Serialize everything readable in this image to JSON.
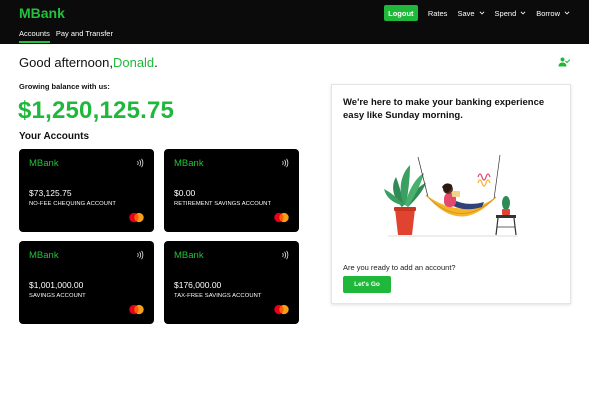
{
  "header": {
    "brand": "MBank",
    "logout_label": "Logout",
    "nav": [
      {
        "label": "Rates",
        "dropdown": false
      },
      {
        "label": "Save",
        "dropdown": true
      },
      {
        "label": "Spend",
        "dropdown": true
      },
      {
        "label": "Borrow",
        "dropdown": true
      }
    ],
    "tabs": [
      {
        "label": "Accounts",
        "active": true
      },
      {
        "label": "Pay and Transfer",
        "active": false
      }
    ]
  },
  "greeting": {
    "prefix": "Good afternoon,",
    "name": "Donald",
    "suffix": "."
  },
  "balance": {
    "label": "Growing balance with us:",
    "value": "$1,250,125.75"
  },
  "accounts": {
    "title": "Your Accounts",
    "cards": [
      {
        "brand": "MBank",
        "amount": "$73,125.75",
        "name": "NO-FEE CHEQUING ACCOUNT"
      },
      {
        "brand": "MBank",
        "amount": "$0.00",
        "name": "RETIREMENT SAVINGS ACCOUNT"
      },
      {
        "brand": "MBank",
        "amount": "$1,001,000.00",
        "name": "SAVINGS ACCOUNT"
      },
      {
        "brand": "MBank",
        "amount": "$176,000.00",
        "name": "TAX-FREE SAVINGS ACCOUNT"
      }
    ]
  },
  "promo": {
    "heading": "We're here to make your banking experience easy like Sunday morning.",
    "question": "Are you ready to add an account?",
    "button_label": "Let's Go",
    "illustration": "person-in-hammock-illustration"
  },
  "icons": {
    "user": "user-check-icon",
    "card_contactless": "contactless-icon",
    "card_network": "mastercard-logo-icon",
    "nav_dropdown": "chevron-down-icon"
  },
  "colors": {
    "accent": "#1fb83a",
    "topbar": "#0b0b0b",
    "card_bg": "#000000",
    "text": "#111111"
  }
}
